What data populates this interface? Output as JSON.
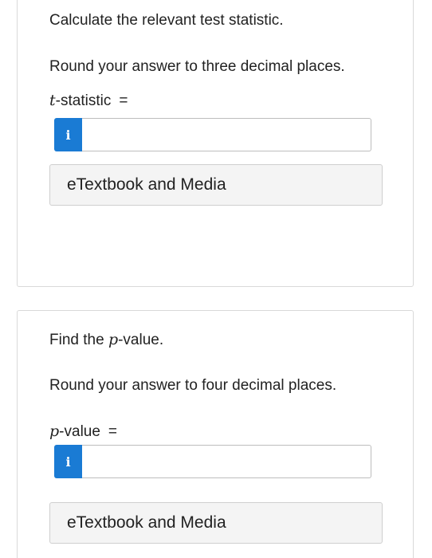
{
  "section1": {
    "instruction": "Calculate the relevant test statistic.",
    "rounding": "Round your answer to three decimal places.",
    "label_var": "t",
    "label_rest": "-statistic",
    "equals": "=",
    "info_icon_glyph": "i",
    "input_value": "",
    "etextbook_label": "eTextbook and Media"
  },
  "section2": {
    "instruction_pre": "Find the ",
    "instruction_var": "p",
    "instruction_post": "-value.",
    "rounding": "Round your answer to four decimal places.",
    "label_var": "p",
    "label_rest": "-value",
    "equals": "=",
    "info_icon_glyph": "i",
    "input_value": "",
    "etextbook_label": "eTextbook and Media"
  },
  "colors": {
    "info_button": "#1a7bd4",
    "card_border": "#d9d9d9",
    "etextbook_bg": "#f4f4f4"
  },
  "icons": {
    "info": "info-icon"
  }
}
